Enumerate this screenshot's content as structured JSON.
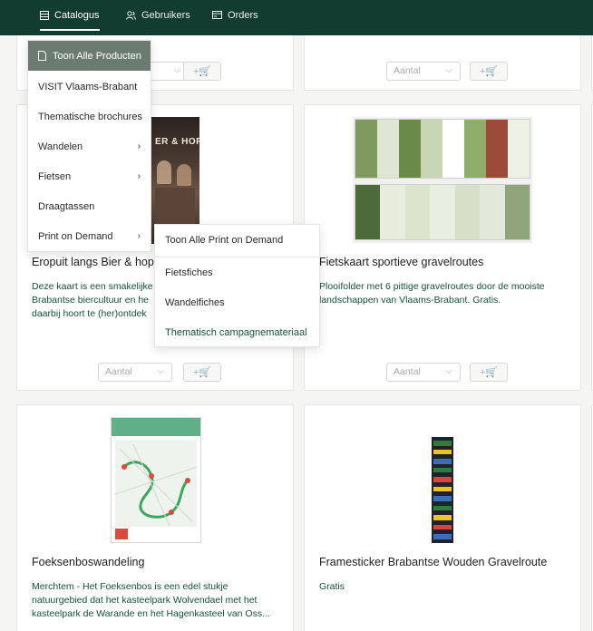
{
  "nav": {
    "items": [
      {
        "label": "Catalogus",
        "icon": "grid-icon",
        "active": true
      },
      {
        "label": "Gebruikers",
        "icon": "users-icon",
        "active": false
      },
      {
        "label": "Orders",
        "icon": "card-icon",
        "active": false
      }
    ]
  },
  "catalog_menu": {
    "items": [
      {
        "label": "Toon Alle Producten",
        "highlight": true
      },
      {
        "label": "VISIT Vlaams-Brabant"
      },
      {
        "label": "Thematische brochures"
      },
      {
        "label": "Wandelen",
        "has_submenu": true
      },
      {
        "label": "Fietsen",
        "has_submenu": true
      },
      {
        "label": "Draagtassen"
      },
      {
        "label": "Print on Demand",
        "has_submenu": true
      }
    ]
  },
  "submenu": {
    "items": [
      {
        "label": "Toon Alle Print on Demand"
      },
      {
        "label": "Fietsfiches"
      },
      {
        "label": "Wandelfiches"
      },
      {
        "label": "Thematisch campagnemateriaal"
      }
    ]
  },
  "qty_placeholder": "Aantal",
  "add_label": "+🛒",
  "products": [
    {
      "title": "Eropuit langs Bier & hop",
      "desc_lines": [
        "Deze kaart is een smakelijke",
        "Brabantse biercultuur en he",
        "daarbij hoort te (her)ontdek"
      ]
    },
    {
      "title": "Fietskaart sportieve gravelroutes",
      "desc_lines": [
        "Plooifolder met 6 pittige gravelroutes door de mooiste",
        "landschappen van Vlaams-Brabant. Gratis."
      ]
    },
    {
      "title": "Foeksenboswandeling",
      "desc_lines": [
        "Merchtem - Het Foeksenbos is een edel stukje",
        "natuurgebied dat het kasteelpark Wolvendael met het",
        "kasteelpark de Warande en het Hagenkasteel van Oss..."
      ]
    },
    {
      "title": "Framesticker Brabantse Wouden Gravelroute",
      "desc_lines": [
        "Gratis"
      ]
    }
  ],
  "image_texts": {
    "beer_cover": "ER & HOP"
  }
}
